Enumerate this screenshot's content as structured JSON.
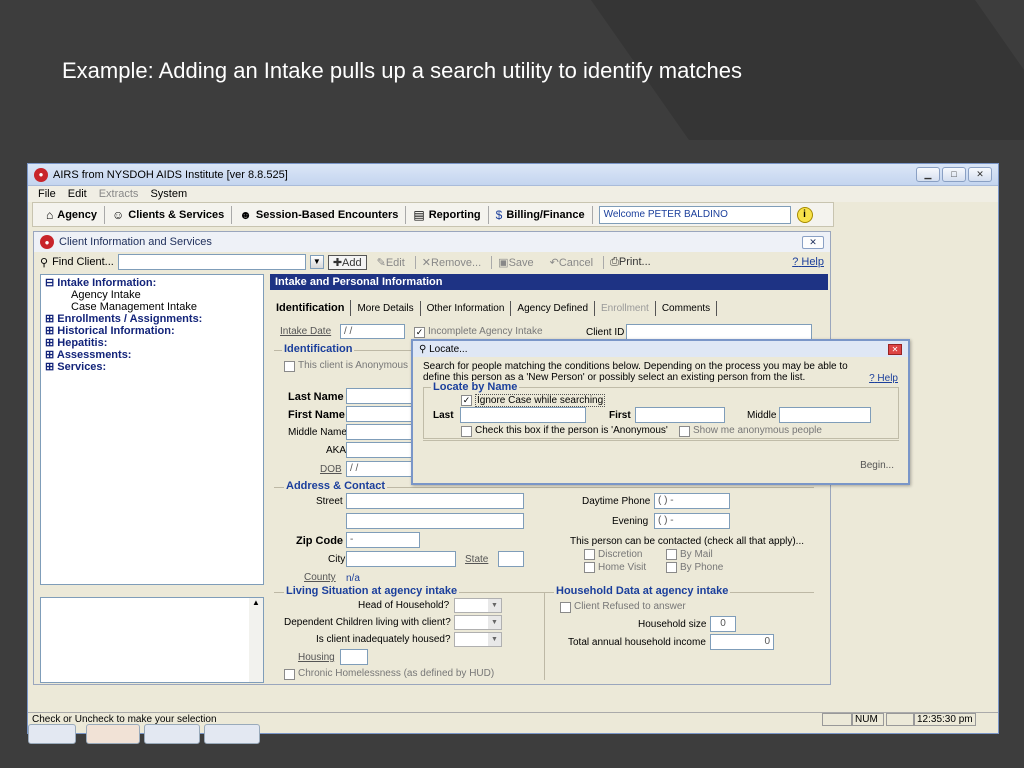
{
  "slide": {
    "title": "Example:  Adding an Intake pulls up a search utility to identify matches"
  },
  "window": {
    "title": "AIRS from NYSDOH AIDS Institute [ver 8.8.525]",
    "menu": [
      "File",
      "Edit",
      "Extracts",
      "System"
    ],
    "toolbar": [
      "Agency",
      "Clients & Services",
      "Session-Based Encounters",
      "Reporting",
      "Billing/Finance"
    ],
    "welcome": "Welcome PETER BALDINO"
  },
  "client": {
    "title": "Client Information and Services",
    "find_label": "Find Client...",
    "buttons": [
      "Add",
      "Edit",
      "Remove...",
      "Save",
      "Cancel",
      "Print..."
    ],
    "help": "Help",
    "tree": {
      "intake": "Intake Information:",
      "agency_intake": "Agency Intake",
      "case_mgmt": "Case Management Intake",
      "enrollments": "Enrollments / Assignments:",
      "historical": "Historical Information:",
      "hepatitis": "Hepatitis:",
      "assessments": "Assessments:",
      "services": "Services:"
    }
  },
  "form": {
    "header": "Intake and Personal Information",
    "tabs": [
      "Identification",
      "More Details",
      "Other Information",
      "Agency Defined",
      "Enrollment",
      "Comments"
    ],
    "intake_date_label": "Intake Date",
    "intake_date_value": " /  /",
    "incomplete_label": "Incomplete Agency Intake",
    "client_id_label": "Client ID",
    "identification_title": "Identification",
    "anonymous_label": "This client is Anonymous",
    "last_name": "Last Name",
    "first_name": "First Name",
    "middle_name": "Middle Name",
    "aka": "AKA",
    "dob": "DOB",
    "dob_value": " /  /",
    "address_title": "Address & Contact",
    "street": "Street",
    "daytime_phone": "Daytime Phone",
    "phone_value": "(   )    -",
    "evening": "Evening",
    "zip": "Zip Code",
    "zip_value": "    -",
    "city": "City",
    "state": "State",
    "county": "County",
    "county_value": "n/a",
    "contact_note": "This person can be contacted (check all that apply)...",
    "discretion": "Discretion",
    "by_mail": "By Mail",
    "home_visit": "Home Visit",
    "by_phone": "By Phone",
    "living_title": "Living Situation at agency intake",
    "head_household": "Head of Household?",
    "dependent_children": "Dependent Children living with client?",
    "inadequately_housed": "Is client inadequately housed?",
    "housing": "Housing",
    "chronic": "Chronic Homelessness (as defined by HUD)",
    "household_title": "Household Data at agency intake",
    "refused": "Client Refused to answer",
    "household_size": "Household size",
    "household_size_value": "0",
    "total_income": "Total annual household income",
    "total_income_value": "0"
  },
  "locate": {
    "title": "Locate...",
    "text": "Search for people matching the conditions below.  Depending on the process you may be able to define this person as a 'New Person' or possibly select an existing person from the list.",
    "help": "Help",
    "group_title": "Locate by Name",
    "ignore_case": "Ignore Case while searching",
    "last": "Last",
    "first": "First",
    "middle": "Middle",
    "anonymous_check": "Check this box if the person is 'Anonymous'",
    "show_anonymous": "Show me anonymous people",
    "begin": "Begin..."
  },
  "status": {
    "message": "Check or Uncheck to make your selection",
    "num": "NUM",
    "time": "12:35:30 pm"
  }
}
